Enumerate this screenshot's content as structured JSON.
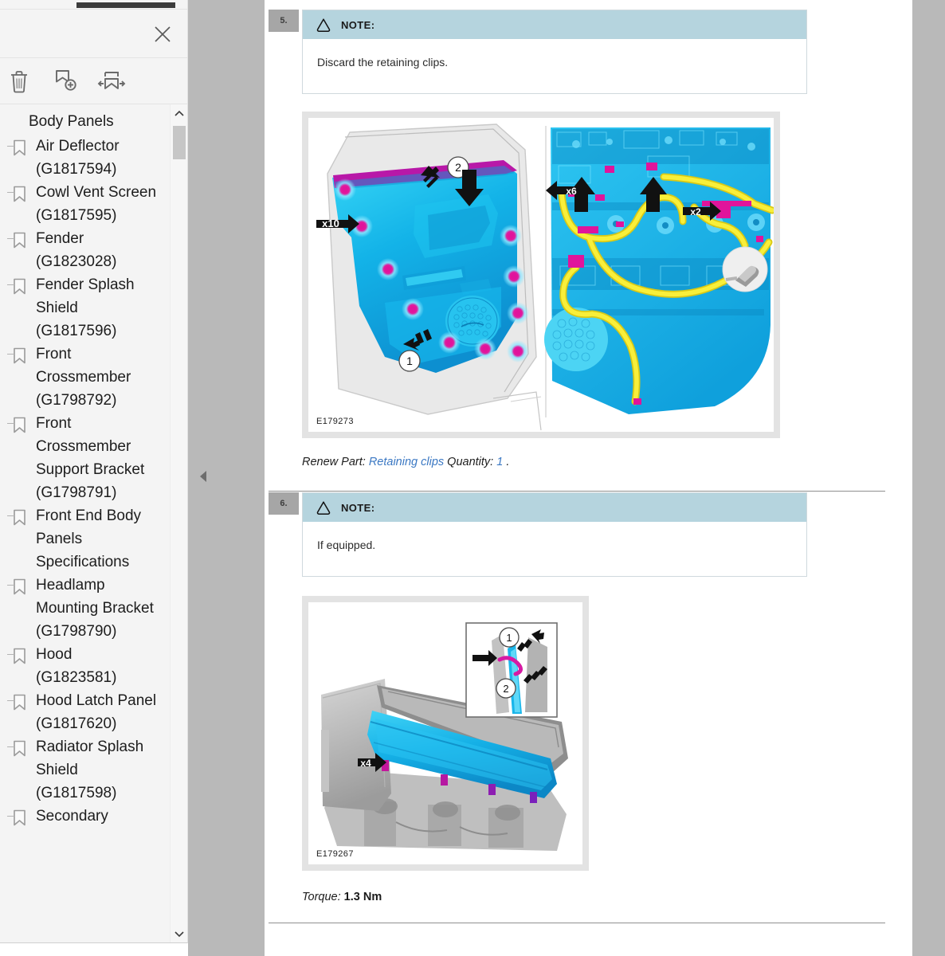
{
  "panel": {
    "title_tab": "bookmarks-tab",
    "close_label": "×",
    "toolbar": [
      {
        "name": "delete-bookmark-button",
        "icon": "trash-icon",
        "label": "Delete"
      },
      {
        "name": "add-bookmark-button",
        "icon": "bookmark-add-icon",
        "label": "New bookmark"
      },
      {
        "name": "expand-bookmark-button",
        "icon": "bookmark-expand-icon",
        "label": "Expand current bookmark"
      }
    ],
    "root_label": "Body Panels",
    "items": [
      {
        "label": "Air Deflector (G1817594)"
      },
      {
        "label": "Cowl Vent Screen (G1817595)"
      },
      {
        "label": "Fender (G1823028)"
      },
      {
        "label": "Fender Splash Shield (G1817596)"
      },
      {
        "label": "Front Crossmember (G1798792)"
      },
      {
        "label": "Front Crossmember Support Bracket (G1798791)"
      },
      {
        "label": "Front End Body Panels Specifications"
      },
      {
        "label": "Headlamp Mounting Bracket (G1798790)"
      },
      {
        "label": "Hood (G1823581)"
      },
      {
        "label": "Hood Latch Panel (G1817620)"
      },
      {
        "label": "Radiator Splash Shield (G1817598)"
      },
      {
        "label": "Secondary"
      }
    ]
  },
  "document": {
    "steps": [
      {
        "number": "5.",
        "note_label": "NOTE:",
        "note_text": "Discard the retaining clips.",
        "figure_id": "E179273",
        "figure_callouts": [
          "2",
          "x10",
          "1",
          "x6",
          "x2"
        ],
        "caption": {
          "prefix": "Renew Part:",
          "part": "Retaining clips",
          "qty_label": "Quantity:",
          "qty_value": "1",
          "suffix": "."
        }
      },
      {
        "number": "6.",
        "note_label": "NOTE:",
        "note_text": "If equipped.",
        "figure_id": "E179267",
        "figure_callouts": [
          "1",
          "2",
          "x4"
        ],
        "caption": {
          "prefix": "Torque:",
          "value": "1.3 Nm"
        }
      }
    ]
  },
  "colors": {
    "note_header": "#b5d4de",
    "step_badge": "#a6a6a6",
    "link": "#3b78c3",
    "part_blue": "#16b4e8",
    "harness_yellow": "#f2e32a",
    "clip_magenta": "#e0149b",
    "viewport_gray": "#b9b9b9"
  }
}
